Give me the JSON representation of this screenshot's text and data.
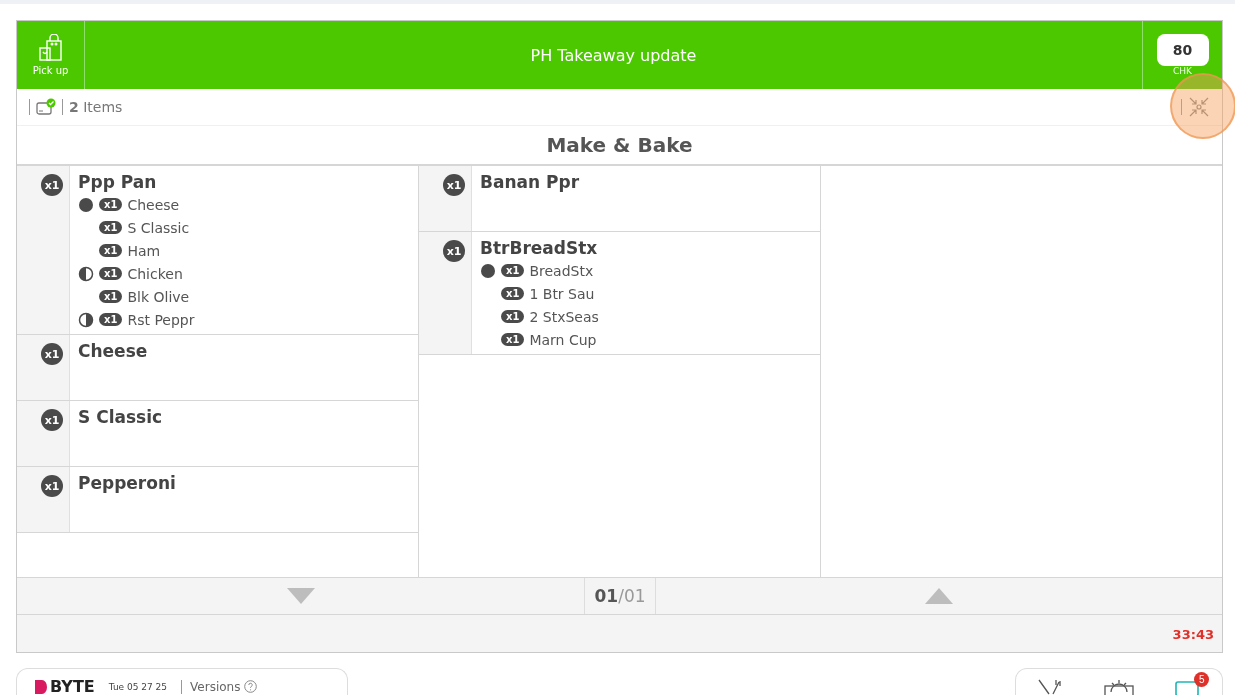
{
  "header": {
    "order_type": "Pick up",
    "title": "PH Takeaway update",
    "check_number": "80",
    "check_label": "CHK"
  },
  "summary": {
    "count": "2",
    "label": "Items"
  },
  "station": "Make & Bake",
  "columns": [
    {
      "items": [
        {
          "qty": "x1",
          "name": "Ppp Pan",
          "modifiers": [
            {
              "kind": "whole",
              "qty": "x1",
              "name": "Cheese"
            },
            {
              "kind": "plain",
              "qty": "x1",
              "name": "S Classic"
            },
            {
              "kind": "plain",
              "qty": "x1",
              "name": "Ham"
            },
            {
              "kind": "left",
              "qty": "x1",
              "name": "Chicken"
            },
            {
              "kind": "plain",
              "qty": "x1",
              "name": "Blk Olive"
            },
            {
              "kind": "right",
              "qty": "x1",
              "name": "Rst Peppr"
            }
          ]
        },
        {
          "qty": "x1",
          "name": "Cheese"
        },
        {
          "qty": "x1",
          "name": "S Classic"
        },
        {
          "qty": "x1",
          "name": "Pepperoni"
        }
      ]
    },
    {
      "items": [
        {
          "qty": "x1",
          "name": "Banan Ppr"
        },
        {
          "qty": "x1",
          "name": "BtrBreadStx",
          "modifiers": [
            {
              "kind": "whole",
              "qty": "x1",
              "name": "BreadStx"
            },
            {
              "kind": "plain",
              "qty": "x1",
              "name": "1 Btr Sau"
            },
            {
              "kind": "plain",
              "qty": "x1",
              "name": "2 StxSeas"
            },
            {
              "kind": "plain",
              "qty": "x1",
              "name": "Marn Cup"
            }
          ]
        }
      ]
    }
  ],
  "pager": {
    "current": "01",
    "total": "/01"
  },
  "timer": "33:43",
  "bottom_bar": {
    "logo": "BYTE",
    "date": "Tue 05 27 25",
    "versions": "Versions",
    "notifications": "5"
  }
}
